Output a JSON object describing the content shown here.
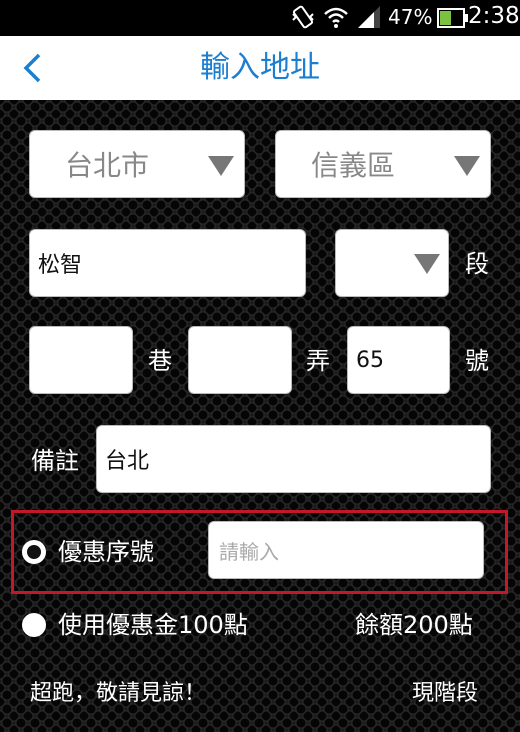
{
  "status": {
    "battery": "47%",
    "time": "2:38"
  },
  "nav": {
    "title": "輸入地址"
  },
  "form": {
    "city": "台北市",
    "district": "信義區",
    "road": "松智",
    "section_value": "",
    "section_label": "段",
    "lane_value": "",
    "lane_label": "巷",
    "alley_value": "",
    "alley_label": "弄",
    "number_value": "65",
    "number_label": "號",
    "note_label": "備註",
    "note_value": "台北"
  },
  "coupon": {
    "label": "優惠序號",
    "placeholder": "請輸入"
  },
  "points": {
    "use_label": "使用優惠金100點",
    "balance_label": "餘額200點"
  },
  "ticker": {
    "left_text": "超跑，敬請見諒！",
    "right_text": "現階段"
  }
}
